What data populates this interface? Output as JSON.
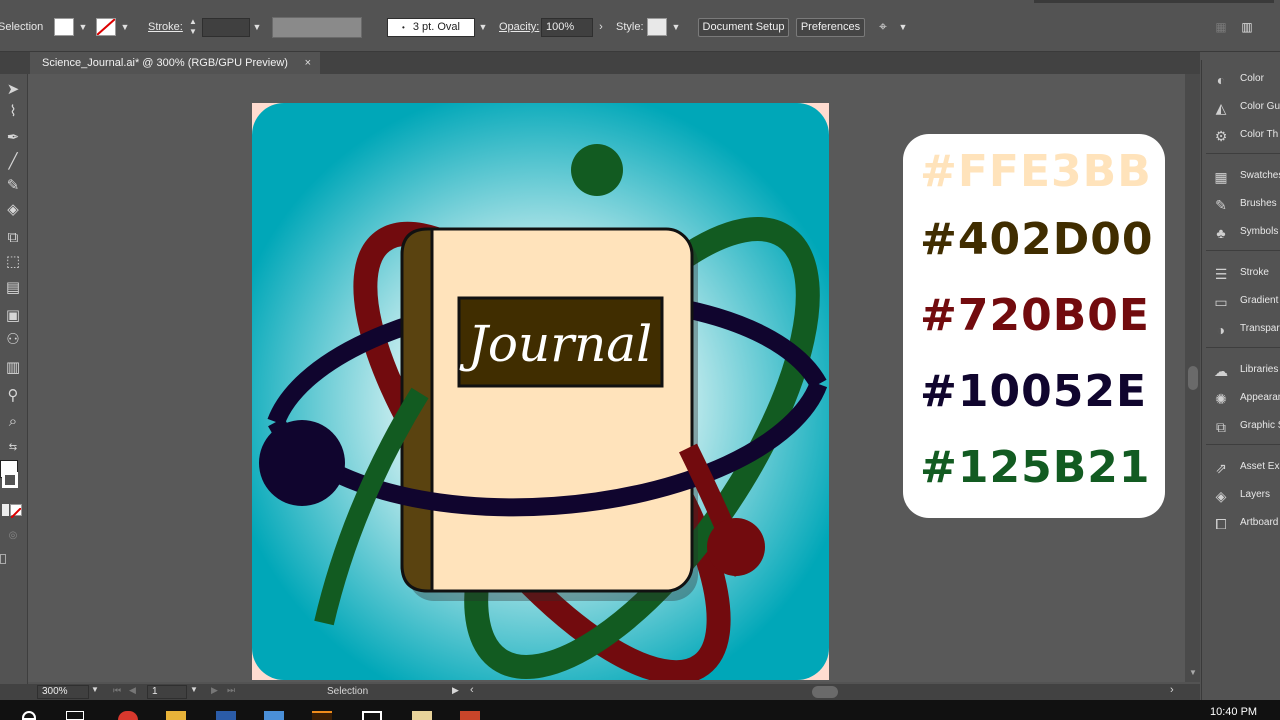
{
  "control_bar": {
    "tool_name": "Selection",
    "stroke_label": "Stroke:",
    "brush_value": "3 pt. Oval",
    "opacity_label": "Opacity:",
    "opacity_value": "100%",
    "style_label": "Style:",
    "document_setup_label": "Document Setup",
    "preferences_label": "Preferences",
    "fill_color": "#ffffff",
    "stroke_color": "none"
  },
  "document_tab": {
    "title": "Science_Journal.ai* @ 300% (RGB/GPU Preview)",
    "close_glyph": "×"
  },
  "artwork": {
    "book_label": "Journal",
    "background_color": "#00a7b8",
    "book_page_color": "#FFE3BB",
    "book_spine_color": "#402D00",
    "orbit_red": "#720B0E",
    "orbit_purple": "#10052E",
    "orbit_green": "#125B21"
  },
  "palette": {
    "swatches": [
      {
        "hex": "#FFE3BB",
        "color": "#FFE3BB"
      },
      {
        "hex": "#402D00",
        "color": "#402D00"
      },
      {
        "hex": "#720B0E",
        "color": "#720B0E"
      },
      {
        "hex": "#10052E",
        "color": "#10052E"
      },
      {
        "hex": "#125B21",
        "color": "#125B21"
      }
    ]
  },
  "status_bar": {
    "zoom": "300%",
    "artboard_number": "1",
    "tool": "Selection"
  },
  "panels": {
    "items": [
      {
        "label": "Color",
        "icon": "color-icon"
      },
      {
        "label": "Color Gu",
        "icon": "color-guide-icon"
      },
      {
        "label": "Color Th",
        "icon": "color-themes-icon"
      },
      {
        "label": "Swatches",
        "icon": "swatches-icon"
      },
      {
        "label": "Brushes",
        "icon": "brushes-icon"
      },
      {
        "label": "Symbols",
        "icon": "symbols-icon"
      },
      {
        "label": "Stroke",
        "icon": "stroke-icon"
      },
      {
        "label": "Gradient",
        "icon": "gradient-icon"
      },
      {
        "label": "Transpar",
        "icon": "transparency-icon"
      },
      {
        "label": "Libraries",
        "icon": "libraries-icon"
      },
      {
        "label": "Appearan",
        "icon": "appearance-icon"
      },
      {
        "label": "Graphic S",
        "icon": "graphic-styles-icon"
      },
      {
        "label": "Asset Exp",
        "icon": "asset-export-icon"
      },
      {
        "label": "Layers",
        "icon": "layers-icon"
      },
      {
        "label": "Artboard",
        "icon": "artboards-icon"
      }
    ]
  },
  "taskbar": {
    "clock": "10:40 PM"
  }
}
